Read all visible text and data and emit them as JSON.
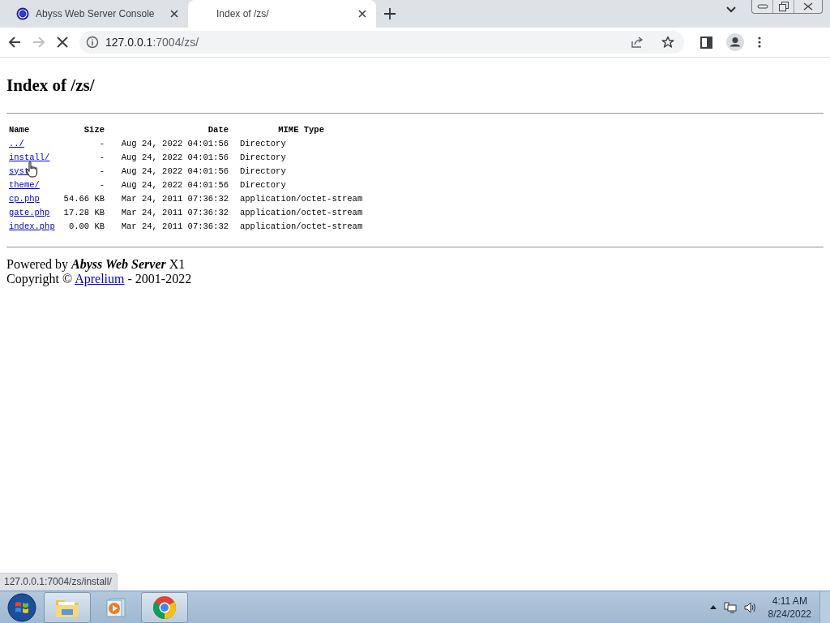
{
  "tabs": [
    {
      "title": "Abyss Web Server Console",
      "favicon": true,
      "selected": false
    },
    {
      "title": "Index of /zs/",
      "favicon": false,
      "selected": true
    }
  ],
  "toolbar": {
    "address_host": "127.0.0.1",
    "address_path": ":7004/zs/",
    "loading": true,
    "forward_disabled": true
  },
  "page": {
    "heading": "Index of /zs/",
    "columns": [
      "Name",
      "Size",
      "Date",
      "MIME Type"
    ],
    "rows": [
      {
        "name": "../",
        "size": "-",
        "date": "Aug 24, 2022 04:01:56",
        "mime": "Directory"
      },
      {
        "name": "install/",
        "size": "-",
        "date": "Aug 24, 2022 04:01:56",
        "mime": "Directory"
      },
      {
        "name": "syst",
        "size": "-",
        "date": "Aug 24, 2022 04:01:56",
        "mime": "Directory"
      },
      {
        "name": "theme/",
        "size": "-",
        "date": "Aug 24, 2022 04:01:56",
        "mime": "Directory"
      },
      {
        "name": "cp.php",
        "size": "54.66 KB",
        "date": "Mar 24, 2011 07:36:32",
        "mime": "application/octet-stream"
      },
      {
        "name": "gate.php",
        "size": "17.28 KB",
        "date": "Mar 24, 2011 07:36:32",
        "mime": "application/octet-stream"
      },
      {
        "name": "index.php",
        "size": "0.00 KB",
        "date": "Mar 24, 2011 07:36:32",
        "mime": "application/octet-stream"
      }
    ],
    "powered": {
      "prefix": "Powered by",
      "product": "Abyss Web Server",
      "suffix": "X1"
    },
    "copyright": {
      "prefix": "Copyright ©",
      "link": "Aprelium",
      "suffix": "- 2001-2022"
    }
  },
  "status_url": "127.0.0.1:7004/zs/install/",
  "taskbar": {
    "apps": [
      {
        "kind": "explorer",
        "active": true
      },
      {
        "kind": "media",
        "active": false
      },
      {
        "kind": "chrome",
        "active": true
      }
    ],
    "time": "4:11 AM",
    "date": "8/24/2022"
  }
}
